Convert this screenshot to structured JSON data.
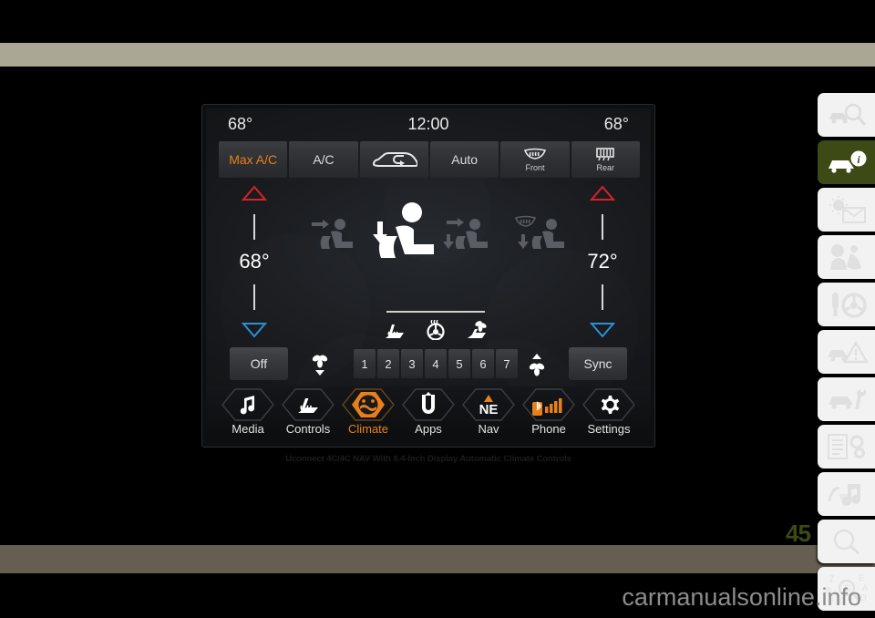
{
  "page": {
    "number": "45",
    "watermark": "carmanualsonline.info",
    "caption": "Uconnect 4C/4C NAV With 8.4-Inch Display Automatic Climate Controls",
    "accent_color": "#e8801a",
    "active_tab_color": "#3d4a16",
    "band_top_color": "#aba795",
    "band_bottom_color": "#665e50"
  },
  "sidebar": {
    "items": [
      {
        "name": "vehicle-identification-icon",
        "label": "",
        "active": false
      },
      {
        "name": "vehicle-info-icon",
        "label": "",
        "active": true
      },
      {
        "name": "getting-started-icon",
        "label": "",
        "active": false
      },
      {
        "name": "safety-icon",
        "label": "",
        "active": false
      },
      {
        "name": "starting-driving-icon",
        "label": "",
        "active": false
      },
      {
        "name": "emergency-icon",
        "label": "",
        "active": false
      },
      {
        "name": "servicing-maintenance-icon",
        "label": "",
        "active": false
      },
      {
        "name": "technical-specifications-icon",
        "label": "",
        "active": false
      },
      {
        "name": "multimedia-icon",
        "label": "",
        "active": false
      },
      {
        "name": "search-icon",
        "label": "",
        "active": false
      },
      {
        "name": "index-icon",
        "label": "",
        "active": false
      }
    ]
  },
  "screen": {
    "statusbar": {
      "left_temp": "68°",
      "clock": "12:00",
      "right_temp": "68°"
    },
    "top_buttons": [
      {
        "label": "Max A/C",
        "icon": "",
        "sub": "",
        "active": true
      },
      {
        "label": "A/C",
        "icon": "",
        "sub": "",
        "active": false
      },
      {
        "label": "",
        "icon": "recirculation-icon",
        "sub": "",
        "active": false
      },
      {
        "label": "Auto",
        "icon": "",
        "sub": "",
        "active": false
      },
      {
        "label": "",
        "icon": "front-defrost-icon",
        "sub": "Front",
        "active": false
      },
      {
        "label": "",
        "icon": "rear-defrost-icon",
        "sub": "Rear",
        "active": false
      }
    ],
    "temp_left": {
      "value": "68°",
      "up_icon": "temp-up-arrow-icon",
      "down_icon": "temp-down-arrow-icon"
    },
    "temp_right": {
      "value": "72°",
      "up_icon": "temp-up-arrow-icon",
      "down_icon": "temp-down-arrow-icon"
    },
    "airflow_modes": [
      {
        "name": "airflow-face-icon",
        "active": false
      },
      {
        "name": "airflow-face-floor-icon",
        "active": true
      },
      {
        "name": "airflow-bi-level-icon",
        "active": false
      },
      {
        "name": "airflow-defrost-floor-icon",
        "active": false
      }
    ],
    "comfort_icons": [
      {
        "name": "heated-seat-icon"
      },
      {
        "name": "heated-steering-wheel-icon"
      },
      {
        "name": "ventilated-seat-icon"
      }
    ],
    "controls": {
      "off_label": "Off",
      "sync_label": "Sync",
      "fan_down_icon": "fan-decrease-icon",
      "fan_up_icon": "fan-increase-icon",
      "fan_levels": [
        "1",
        "2",
        "3",
        "4",
        "5",
        "6",
        "7"
      ],
      "fan_level_selected": null
    },
    "nav": [
      {
        "label": "Media",
        "icon": "music-note-icon",
        "active": false
      },
      {
        "label": "Controls",
        "icon": "heated-seat-icon",
        "active": false
      },
      {
        "label": "Climate",
        "icon": "climate-icon",
        "active": true
      },
      {
        "label": "Apps",
        "icon": "uconnect-u-icon",
        "active": false
      },
      {
        "label": "Nav",
        "icon": "compass-ne-icon",
        "active": false,
        "badge": "NE"
      },
      {
        "label": "Phone",
        "icon": "bluetooth-signal-icon",
        "active": false
      },
      {
        "label": "Settings",
        "icon": "gear-icon",
        "active": false
      }
    ]
  }
}
